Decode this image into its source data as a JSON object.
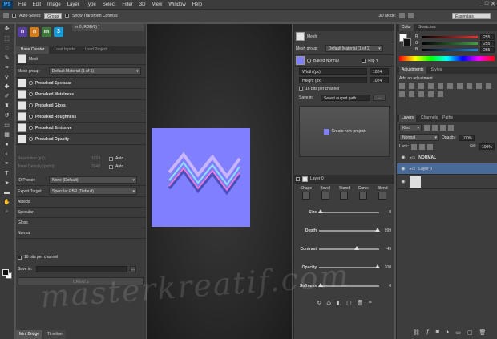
{
  "menubar": {
    "logo": "Ps",
    "items": [
      "File",
      "Edit",
      "Image",
      "Layer",
      "Type",
      "Select",
      "Filter",
      "3D",
      "View",
      "Window",
      "Help"
    ],
    "window_buttons": [
      "_",
      "□",
      "✕"
    ]
  },
  "options": {
    "auto_select_label": "Auto-Select:",
    "auto_select_value": "Group",
    "transform_label": "Show Transform Controls",
    "mode_3d": "3D Mode:",
    "workspace": "Essentials"
  },
  "doc_tab": "er 0, RGB/8) *",
  "left_panel": {
    "tabs": [
      "Base Creator",
      "Load Inputs",
      "Load Project..."
    ],
    "mesh_label": "Mesh",
    "mesh_group_label": "Mesh group:",
    "mesh_group_value": "Default Material (1 of 1)",
    "items": [
      "Prebaked Specular",
      "Prebaked Metalness",
      "Prebaked Gloss",
      "Prebaked Roughness",
      "Prebaked Emissive",
      "Prebaked Opacity"
    ],
    "resolution_label": "Resolution (px):",
    "resolution_value": "1024",
    "texel_label": "Texel Density (px/m):",
    "texel_value": "2048",
    "auto_label": "Auto",
    "id_preset_label": "ID Preset:",
    "id_preset_value": "None (Default)",
    "export_target_label": "Export Target:",
    "export_target_value": "Specular PBR (Default)",
    "outputs": [
      "Albedo",
      "Specular",
      "Gloss",
      "Normal"
    ],
    "bits_label": "16 bits per channel",
    "save_label": "Save in:",
    "create_label": "CREATE",
    "browse": "..."
  },
  "right_panel": {
    "mesh_label": "Mesh",
    "mesh_group_label": "Mesh group:",
    "mesh_group_value": "Default Material (1 of 1)",
    "baked_normal": "Baked Normal",
    "flip_y": "Flip Y",
    "width_label": "Width (px)",
    "width_value": "1024",
    "height_label": "Height (px)",
    "height_value": "1024",
    "bits_label": "16 bits per channel",
    "save_label": "Save in:",
    "save_value": "Select output path",
    "browse": "...",
    "create_new": "Create new project",
    "layer_label": "Layer 0",
    "tools": [
      "Shape",
      "Bevel",
      "Stand",
      "Curve",
      "Blend"
    ],
    "sliders": [
      {
        "label": "Size",
        "value": "0",
        "pos": 0.02
      },
      {
        "label": "Depth",
        "value": "999",
        "pos": 0.97
      },
      {
        "label": "Contrast",
        "value": "49",
        "pos": 0.62
      },
      {
        "label": "Opacity",
        "value": "100",
        "pos": 0.97
      },
      {
        "label": "Softness",
        "value": "0",
        "pos": 0.02
      }
    ]
  },
  "far_right": {
    "color_tabs": [
      "Color",
      "Swatches"
    ],
    "rgb": [
      {
        "label": "R",
        "value": "255",
        "color": "#e53935"
      },
      {
        "label": "G",
        "value": "255",
        "color": "#43a047"
      },
      {
        "label": "B",
        "value": "255",
        "color": "#1e88e5"
      }
    ],
    "adjust_tabs": [
      "Adjustments",
      "Styles"
    ],
    "adjust_hint": "Add an adjustment",
    "layer_tabs": [
      "Layers",
      "Channels",
      "Paths"
    ],
    "kind_label": "Kind",
    "blend_mode": "Normal",
    "opacity_label": "Opacity:",
    "opacity_value": "100%",
    "lock_label": "Lock:",
    "fill_label": "Fill:",
    "fill_value": "100%",
    "layers": [
      "NORMAL",
      "Layer 0"
    ]
  },
  "watermark": "masterkreatif.com",
  "bottom_tabs": [
    "Mini Bridge",
    "Timeline"
  ]
}
